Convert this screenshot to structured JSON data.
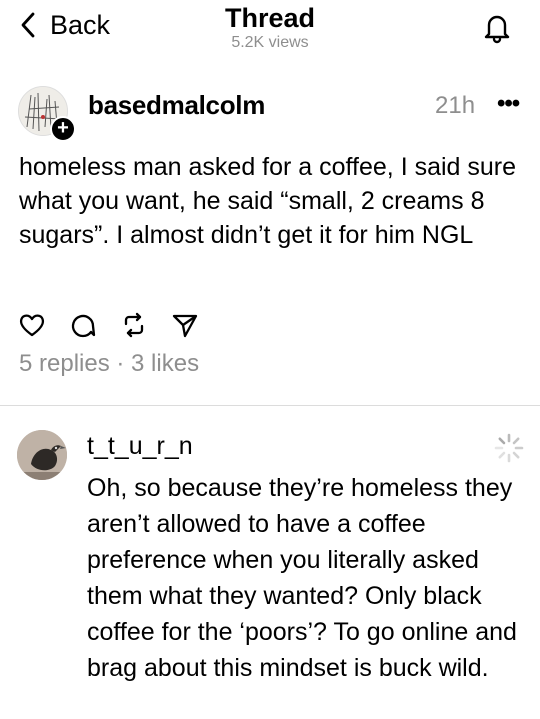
{
  "header": {
    "back_label": "Back",
    "title": "Thread",
    "views": "5.2K views"
  },
  "post": {
    "username": "basedmalcolm",
    "time": "21h",
    "more": "•••",
    "text": "homeless man asked for a coffee, I said sure what you want, he said “small, 2 creams 8 sugars”. I almost didn’t get it for him NGL",
    "stats": "5 replies · 3 likes",
    "badge": "+"
  },
  "reply": {
    "username": "t_t_u_r_n",
    "text": "Oh, so because they’re homeless they aren’t allowed to have a coffee preference when you literally asked them what they wanted? Only black coffee for the ‘poors’? To go online and brag about this mindset is buck wild."
  }
}
